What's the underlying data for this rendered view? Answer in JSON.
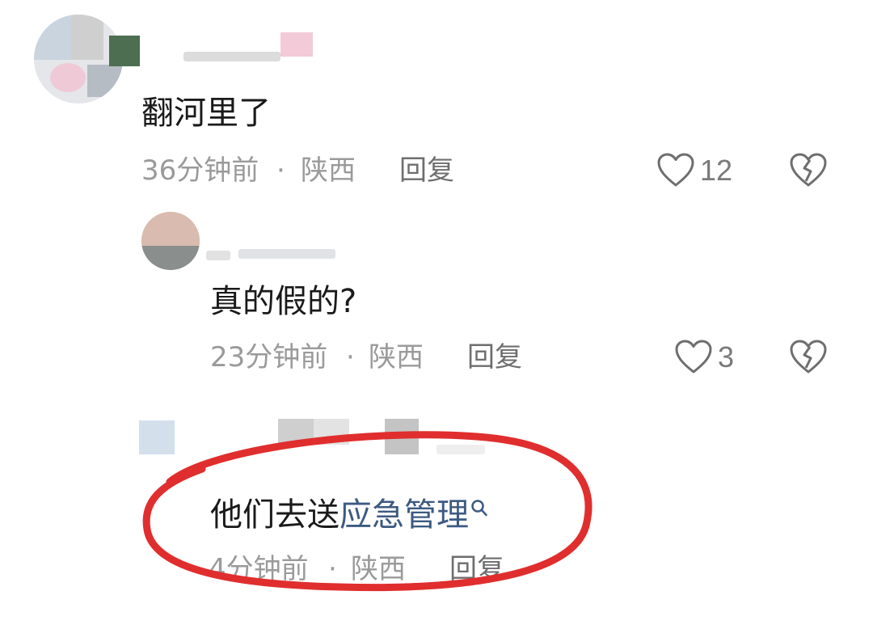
{
  "comments": [
    {
      "text": "翻河里了",
      "time": "36分钟前",
      "separator": "·",
      "location": "陕西",
      "reply_label": "回复",
      "likes": "12"
    },
    {
      "text": "真的假的?",
      "time": "23分钟前",
      "separator": "·",
      "location": "陕西",
      "reply_label": "回复",
      "likes": "3"
    },
    {
      "text_plain": "他们去送",
      "text_link": "应急管理",
      "time": "4分钟前",
      "separator": "·",
      "location": "陕西",
      "reply_label": "回复"
    }
  ],
  "icons": {
    "like": "heart-outline-icon",
    "dislike": "broken-heart-icon",
    "search": "search-icon"
  },
  "colors": {
    "annotation_circle": "#e02e2e",
    "link": "#3c5a82",
    "meta": "#9a9a9a"
  }
}
